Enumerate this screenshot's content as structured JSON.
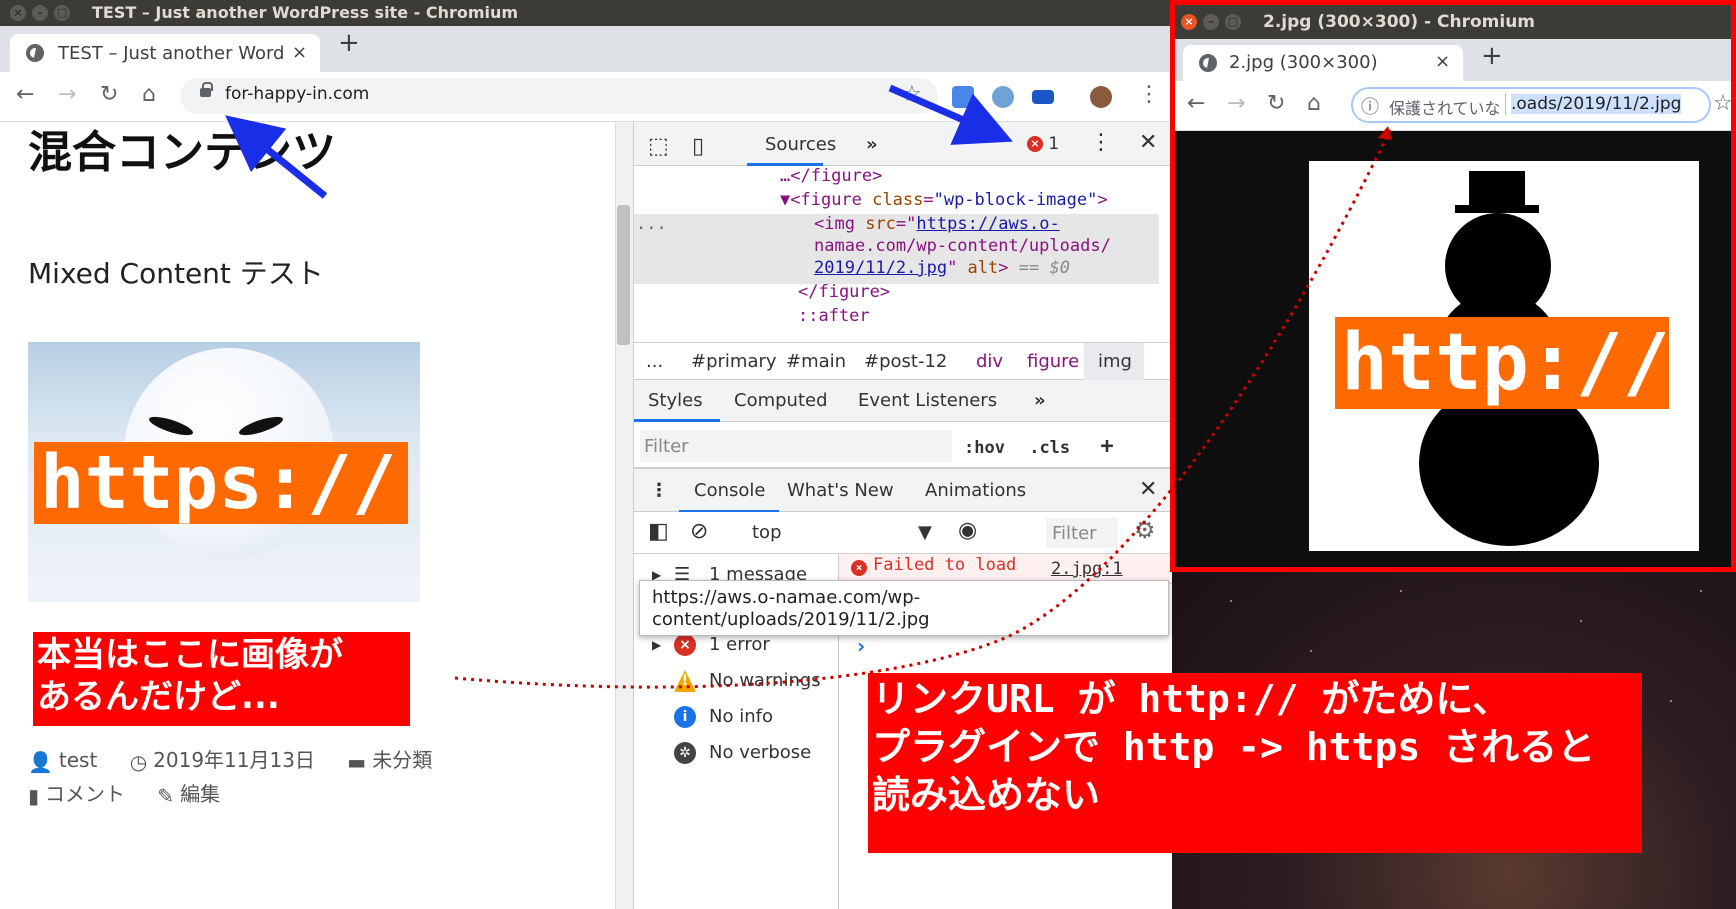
{
  "main_window": {
    "title": "TEST – Just another WordPress site - Chromium",
    "tab_title": "TEST – Just another Word",
    "tab_close": "×",
    "new_tab": "+",
    "url": "for-happy-in.com"
  },
  "page": {
    "heading": "混合コンテンツ",
    "subheading": "Mixed Content テスト",
    "image_band_text": "https://",
    "note": "本当はここに画像が\nあるんだけど...",
    "meta": {
      "author": "test",
      "date": "2019年11月13日",
      "category": "未分類",
      "comment": "コメント",
      "edit": "編集"
    }
  },
  "devtools": {
    "panel_tab": "Sources",
    "more": "»",
    "error_count": "1",
    "dom": {
      "line1": "…</figure>",
      "line2_tag": "<figure",
      "line2_attr": "class",
      "line2_val": "\"wp-block-image\"",
      "line3_tag": "<img",
      "line3_attr": "src",
      "src_part1": "https://aws.o-",
      "src_part2": "namae.com/wp-content/uploads/",
      "src_part3": "2019/11/2.jpg",
      "alt": "alt",
      "eq": "== $0",
      "line6": "</figure>",
      "line7": "::after",
      "ellipsis": "..."
    },
    "breadcrumbs": [
      "...",
      "#primary",
      "#main",
      "#post-12",
      "div",
      "figure",
      "img"
    ],
    "styles_tabs": [
      "Styles",
      "Computed",
      "Event Listeners",
      "»"
    ],
    "filter_placeholder": "Filter",
    "hov": ":hov",
    "cls": ".cls",
    "plus": "+",
    "console_tabs": [
      "Console",
      "What's New",
      "Animations"
    ],
    "context": "top",
    "console_filter": "Filter",
    "sidebar": {
      "messages": "1 message",
      "errors": "1 error",
      "warnings": "No warnings",
      "info": "No info",
      "verbose": "No verbose"
    },
    "error_text": "Failed to load",
    "error_source": "2.jpg:1",
    "tooltip": "https://aws.o-namae.com/wp-content/uploads/2019/11/2.jpg",
    "prompt": "›"
  },
  "big_note": "リンクURL が http:// がために、\nプラグインで http -> https されると\n読み込めない",
  "popup_window": {
    "title": "2.jpg (300×300) - Chromium",
    "tab_title": "2.jpg (300×300)",
    "tab_close": "×",
    "new_tab": "+",
    "insecure_label": "保護されていな",
    "url": ".oads/2019/11/2.jpg",
    "image_band_text": "http://"
  },
  "colors": {
    "annotation_red": "#ff0000",
    "orange_band": "#ff6a00",
    "arrow_blue": "#1a2ee8",
    "devtools_blue": "#1a73e8"
  }
}
